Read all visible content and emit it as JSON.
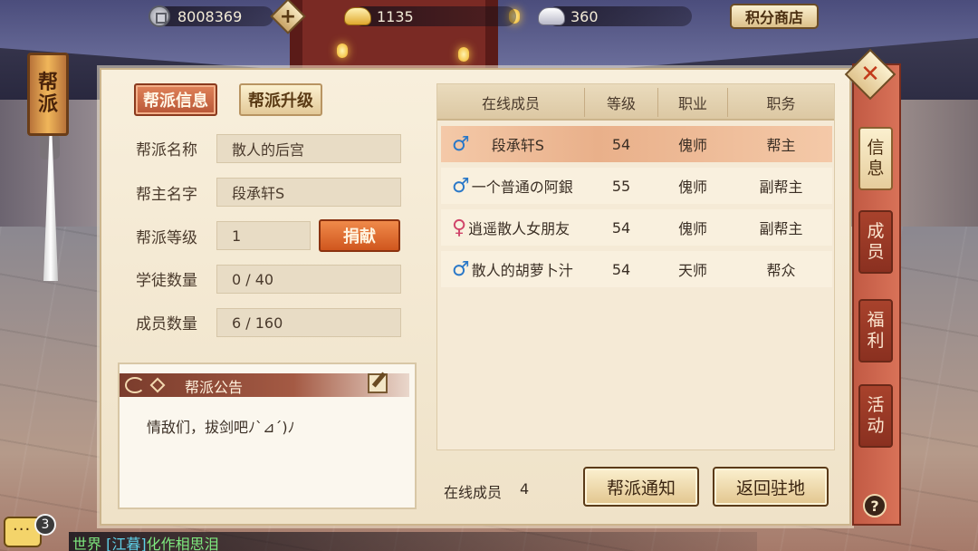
{
  "currencies": {
    "coins": "8008369",
    "gold_ingots": "1135",
    "silver_ingots": "360"
  },
  "topbar": {
    "add_label": "+",
    "shop_label": "积分商店"
  },
  "banner": {
    "label_line1": "帮",
    "label_line2": "派"
  },
  "tabs": {
    "info": "帮派信息",
    "upgrade": "帮派升级"
  },
  "fields": {
    "guild_name_label": "帮派名称",
    "guild_name_value": "散人的后宫",
    "leader_label": "帮主名字",
    "leader_value": "段承轩S",
    "level_label": "帮派等级",
    "level_value": "1",
    "apprentice_label": "学徒数量",
    "apprentice_value": "0 / 40",
    "member_label": "成员数量",
    "member_value": "6 / 160"
  },
  "donate_label": "捐献",
  "notice": {
    "title": "帮派公告",
    "text": "情敌们，拔剑吧ﾉ`⊿´)ﾉ"
  },
  "table": {
    "headers": [
      "在线成员",
      "等级",
      "职业",
      "职务"
    ],
    "rows": [
      {
        "gender": "male",
        "symbol": "♂",
        "name": "段承轩S",
        "level": "54",
        "class": "傀师",
        "role": "帮主",
        "selected": true
      },
      {
        "gender": "male",
        "symbol": "♂",
        "name": "一个普通の阿銀",
        "level": "55",
        "class": "傀师",
        "role": "副帮主",
        "selected": false
      },
      {
        "gender": "female",
        "symbol": "♀",
        "name": "逍遥散人女朋友",
        "level": "54",
        "class": "傀师",
        "role": "副帮主",
        "selected": false
      },
      {
        "gender": "male",
        "symbol": "♂",
        "name": "散人的胡萝卜汁",
        "level": "54",
        "class": "天师",
        "role": "帮众",
        "selected": false
      }
    ]
  },
  "footer": {
    "online_label": "在线成员",
    "online_count": "4",
    "notify_button": "帮派通知",
    "return_button": "返回驻地"
  },
  "side_tabs": [
    {
      "line1": "信",
      "line2": "息",
      "active": true
    },
    {
      "line1": "成",
      "line2": "员",
      "active": false
    },
    {
      "line1": "福",
      "line2": "利",
      "active": false
    },
    {
      "line1": "活",
      "line2": "动",
      "active": false
    }
  ],
  "close_label": "✕",
  "help_label": "?",
  "chat": {
    "badge": "3",
    "channel": "世界",
    "user": "[江暮]",
    "message": "化作相思泪"
  }
}
